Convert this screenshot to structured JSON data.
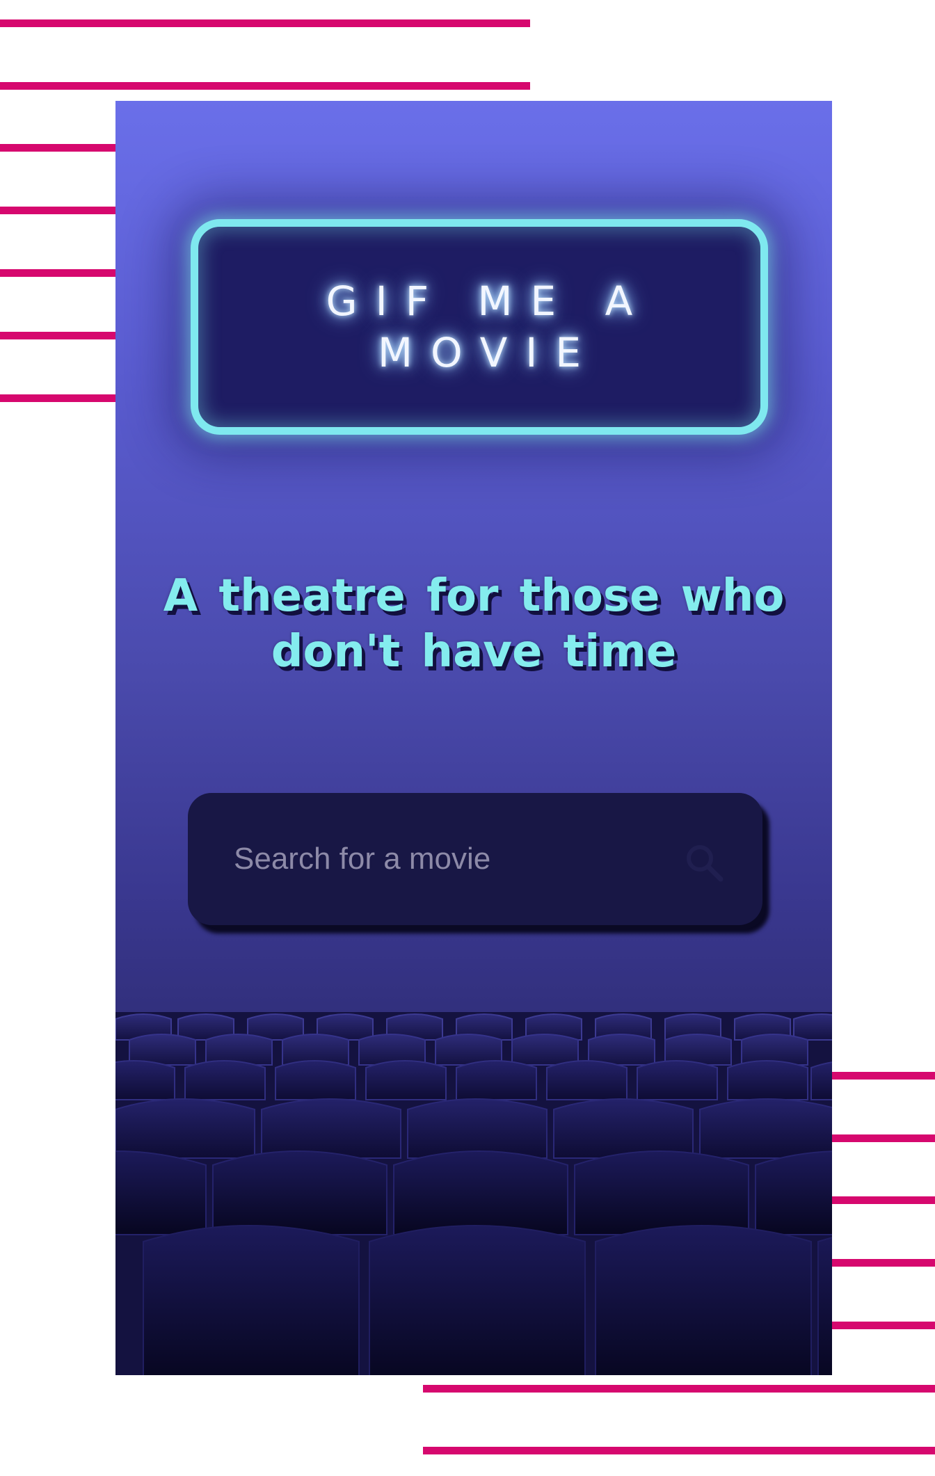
{
  "app": {
    "title": "GIF ME A MOVIE",
    "tagline": "A theatre for those who don't have time"
  },
  "search": {
    "placeholder": "Search for a movie",
    "value": "",
    "icon": "search-icon"
  },
  "colors": {
    "stripe": "#d6086e",
    "neon": "#7fe8ef",
    "tagline": "#84ecee",
    "search_bg": "#181745"
  }
}
